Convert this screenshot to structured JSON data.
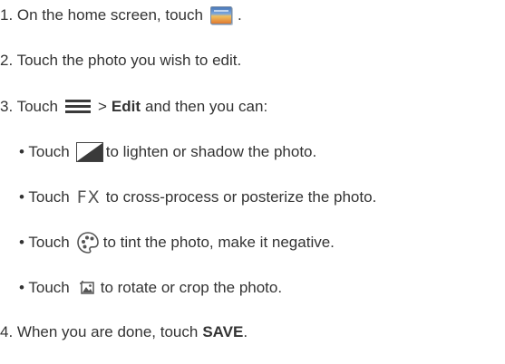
{
  "steps": {
    "step1": {
      "text": "1. On the home screen, touch",
      "end": ".",
      "icon": "gallery-icon"
    },
    "step2": {
      "text": "2. Touch the photo you wish to edit."
    },
    "step3": {
      "pre": "3. Touch",
      "sep": ">",
      "bold": "Edit",
      "post": "and then you can:",
      "icon": "menu-icon"
    },
    "bullets": [
      {
        "pre": "• Touch",
        "post": "to lighten or shadow the photo.",
        "icon": "exposure-icon"
      },
      {
        "pre": "• Touch",
        "glyph": "FX",
        "post": "to cross-process or posterize the photo.",
        "icon": "fx-icon"
      },
      {
        "pre": "• Touch",
        "post": "to tint the photo, make it negative.",
        "icon": "tint-icon"
      },
      {
        "pre": "• Touch",
        "post": "to rotate or crop the photo.",
        "icon": "crop-icon"
      }
    ],
    "step4": {
      "pre": "4. When you are done, touch",
      "bold": "SAVE",
      "end": "."
    }
  }
}
